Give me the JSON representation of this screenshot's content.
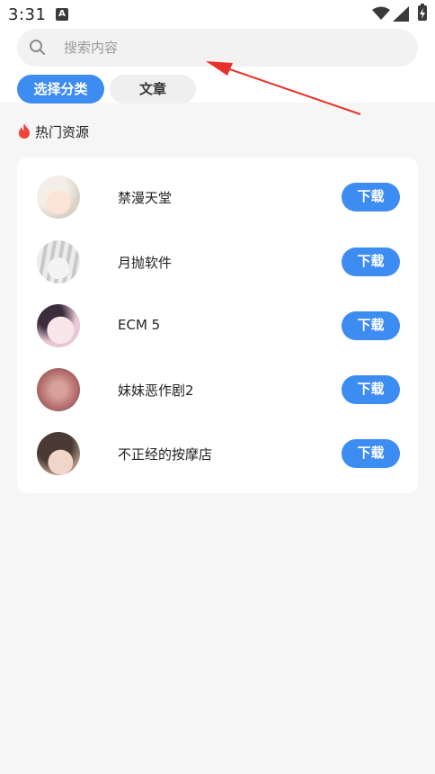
{
  "status_bar": {
    "time": "3:31",
    "notification_icon": "a-letter-icon",
    "wifi_icon": "wifi-icon",
    "signal_icon": "cell-signal-icon",
    "battery_icon": "battery-charging-icon"
  },
  "search": {
    "placeholder": "搜索内容",
    "value": "",
    "icon": "search-icon"
  },
  "tabs": [
    {
      "label": "选择分类",
      "active": true
    },
    {
      "label": "文章",
      "active": false
    }
  ],
  "hot_section": {
    "icon": "fire-icon",
    "title": "热门资源"
  },
  "resources": [
    {
      "name": "禁漫天堂",
      "button": "下载"
    },
    {
      "name": "月抛软件",
      "button": "下载"
    },
    {
      "name": "ECM 5",
      "button": "下载"
    },
    {
      "name": "妹妹恶作剧2",
      "button": "下载"
    },
    {
      "name": "不正经的按摩店",
      "button": "下载"
    }
  ],
  "colors": {
    "accent": "#3c8cf2",
    "annotation_arrow": "#e8302a",
    "fire": "#f0443a"
  }
}
